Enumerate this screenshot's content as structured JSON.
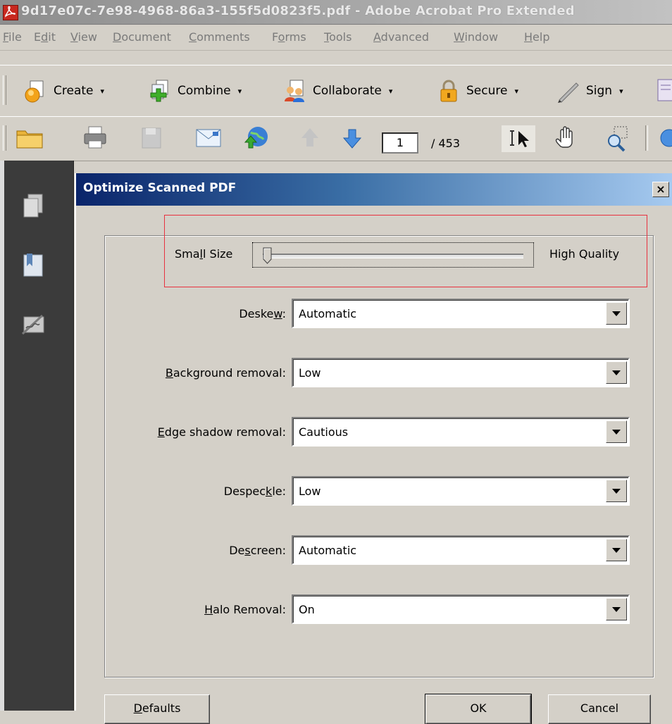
{
  "window": {
    "title": "9d17e07c-7e98-4968-86a3-155f5d0823f5.pdf - Adobe Acrobat Pro Extended"
  },
  "menu": {
    "items": [
      {
        "pre": "",
        "key": "F",
        "post": "ile"
      },
      {
        "pre": "E",
        "key": "d",
        "post": "it"
      },
      {
        "pre": "",
        "key": "V",
        "post": "iew"
      },
      {
        "pre": "",
        "key": "D",
        "post": "ocument"
      },
      {
        "pre": "",
        "key": "C",
        "post": "omments"
      },
      {
        "pre": "F",
        "key": "o",
        "post": "rms"
      },
      {
        "pre": "",
        "key": "T",
        "post": "ools"
      },
      {
        "pre": "",
        "key": "A",
        "post": "dvanced"
      },
      {
        "pre": "",
        "key": "W",
        "post": "indow"
      },
      {
        "pre": "",
        "key": "H",
        "post": "elp"
      }
    ]
  },
  "toolbar": {
    "create_label": "Create",
    "combine_label": "Combine",
    "collaborate_label": "Collaborate",
    "secure_label": "Secure",
    "sign_label": "Sign",
    "dropdown_glyph": "▾"
  },
  "navigation": {
    "current_page": "1",
    "total_pages": "/ 453"
  },
  "dialog": {
    "title": "Optimize Scanned PDF",
    "close_glyph": "×",
    "slider": {
      "left_label_pre": "Sma",
      "left_label_key": "l",
      "left_label_post": "l Size",
      "right_label": "High Quality",
      "value": 0
    },
    "rows": [
      {
        "pre": "Deske",
        "key": "w",
        "post": ":",
        "value": "Automatic"
      },
      {
        "pre": "",
        "key": "B",
        "post": "ackground removal:",
        "value": "Low"
      },
      {
        "pre": "",
        "key": "E",
        "post": "dge shadow removal:",
        "value": "Cautious"
      },
      {
        "pre": "Despec",
        "key": "k",
        "post": "le:",
        "value": "Low"
      },
      {
        "pre": "De",
        "key": "s",
        "post": "creen:",
        "value": "Automatic"
      },
      {
        "pre": "",
        "key": "H",
        "post": "alo Removal:",
        "value": "On"
      }
    ],
    "buttons": {
      "defaults_pre": "",
      "defaults_key": "D",
      "defaults_post": "efaults",
      "ok": "OK",
      "cancel": "Cancel"
    }
  },
  "colors": {
    "highlight": "#e8313f",
    "dialog_title_start": "#0a246a",
    "dialog_title_end": "#a6caf0"
  }
}
